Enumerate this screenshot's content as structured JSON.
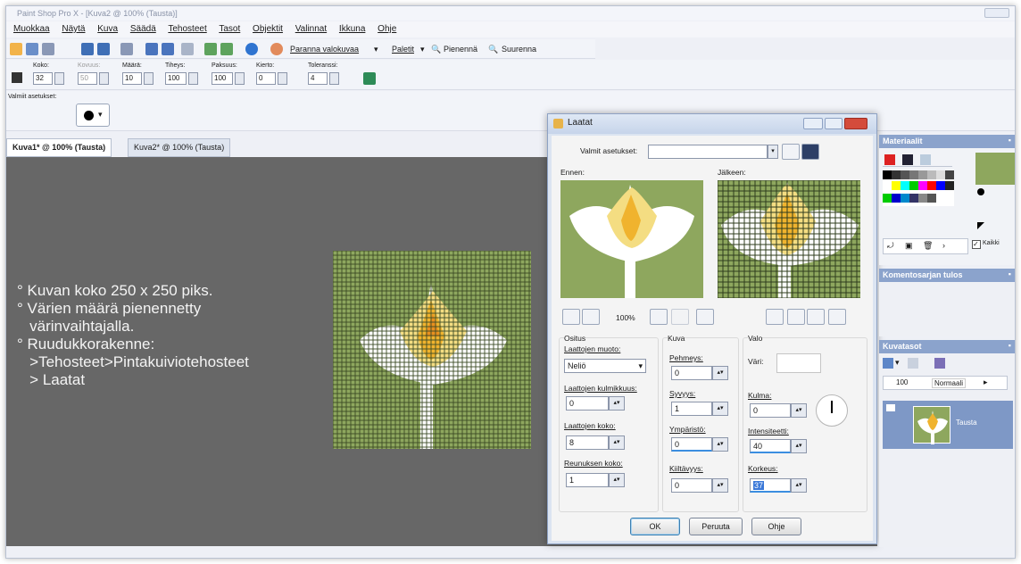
{
  "app": {
    "title": "Paint Shop Pro X - [Kuva2 @ 100% (Tausta)]"
  },
  "menu": [
    "Muokkaa",
    "Näytä",
    "Kuva",
    "Säädä",
    "Tehosteet",
    "Tasot",
    "Objektit",
    "Valinnat",
    "Ikkuna",
    "Ohje"
  ],
  "toolbar": {
    "enhance": "Paranna valokuvaa",
    "palettes": "Paletit",
    "zoom_out": "Pienennä",
    "zoom_in": "Suurenna"
  },
  "options": {
    "labels": [
      "Koko:",
      "Kovuus:",
      "Määrä:",
      "Tiheys:",
      "Paksuus:",
      "Kierto:",
      "Toleranssi:"
    ],
    "values": [
      "32",
      "50",
      "10",
      "100",
      "100",
      "0",
      "4"
    ]
  },
  "presets_label": "Valmiit asetukset:",
  "tabs": [
    "Kuva1* @ 100% (Tausta)",
    "Kuva2* @ 100% (Tausta)"
  ],
  "bullets": [
    "° Kuvan koko 250 x 250 piks.",
    "° Värien määrä pienennetty",
    "   värinvaihtajalla.",
    "° Ruudukkorakenne:",
    "   >Tehosteet>Pintakuiviotehosteet",
    "   > Laatat"
  ],
  "dialog": {
    "title": "Laatat",
    "presets_label": "Valmit asetukset:",
    "before": "Ennen:",
    "after": "Jälkeen:",
    "zoom": "100%",
    "group_division": "Ositus",
    "group_image": "Kuva",
    "group_light": "Valo",
    "shape_label": "Laattojen muoto:",
    "shape_value": "Neliö",
    "angle_label": "Laattojen kulmikkuus:",
    "angle_value": "0",
    "size_label": "Laattojen koko:",
    "size_value": "8",
    "border_label": "Reunuksen koko:",
    "border_value": "1",
    "soft_label": "Pehmeys:",
    "soft_value": "0",
    "depth_label": "Syvyys:",
    "depth_value": "1",
    "amb_label": "Ympäristö:",
    "amb_value": "0",
    "shine_label": "Kiiltävyys:",
    "shine_value": "0",
    "color_label": "Väri:",
    "light_angle_label": "Kulma:",
    "light_angle_value": "0",
    "intensity_label": "Intensiteetti:",
    "intensity_value": "40",
    "height_label": "Korkeus:",
    "height_value": "37",
    "ok": "OK",
    "cancel": "Peruuta",
    "help": "Ohje"
  },
  "panels": {
    "materials": "Materiaalit",
    "all_label": "Kaikki",
    "script_output": "Komentosarjan tulos",
    "layers": "Kuvatasot",
    "opacity": "100",
    "blend": "Normaali",
    "layer_name": "Tausta"
  },
  "colors": {
    "green": "#8ea75e",
    "dialog_bg": "#f4f4f4",
    "panel_header": "#8ba3cc",
    "canvas": "#676767"
  }
}
